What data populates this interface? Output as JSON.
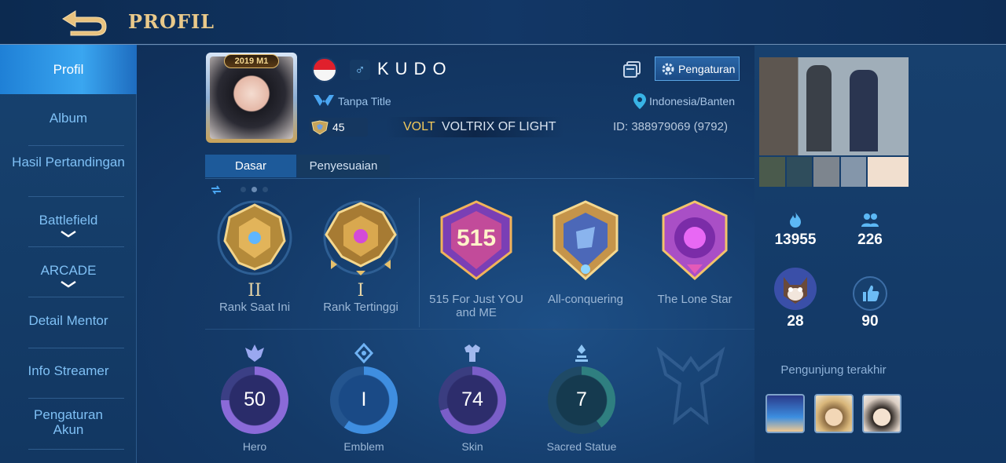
{
  "header": {
    "title": "PROFIL"
  },
  "sidebar": {
    "items": [
      {
        "label": "Profil"
      },
      {
        "label": "Album"
      },
      {
        "label": "Hasil Pertandingan"
      },
      {
        "label": "Battlefield"
      },
      {
        "label": "ARCADE"
      },
      {
        "label": "Detail Mentor"
      },
      {
        "label": "Info Streamer"
      },
      {
        "label": "Pengaturan Akun"
      }
    ]
  },
  "profile": {
    "frame_year": "2019 M1",
    "gender_symbol": "♂",
    "name": "KUDO",
    "title": "Tanpa Title",
    "location": "Indonesia/Banten",
    "level": "45",
    "squad_tag": "VOLT",
    "squad_name": "VOLTRIX OF LIGHT",
    "id_label": "ID:",
    "id_value": "388979069 (9792)",
    "settings_label": "Pengaturan"
  },
  "tabs": [
    {
      "label": "Dasar",
      "active": true
    },
    {
      "label": "Penyesuaian",
      "active": false
    }
  ],
  "medals": [
    {
      "roman": "II",
      "label": "Rank Saat Ini"
    },
    {
      "roman": "I",
      "label": "Rank Tertinggi"
    },
    {
      "label": "515 For Just YOU and ME",
      "art_text": "515"
    },
    {
      "label": "All-conquering"
    },
    {
      "label": "The Lone Star"
    }
  ],
  "stats": [
    {
      "value": "50",
      "label": "Hero",
      "color": "#8a6ad8"
    },
    {
      "value": "I",
      "label": "Emblem",
      "color": "#3f8ee0"
    },
    {
      "value": "74",
      "label": "Skin",
      "color": "#7a5ec8"
    },
    {
      "value": "7",
      "label": "Sacred Statue",
      "color": "#2f7f80"
    }
  ],
  "right": {
    "popularity": "13955",
    "friends": "226",
    "pet_count": "28",
    "likes": "90",
    "visitors_label": "Pengunjung terakhir"
  },
  "colors": {
    "accent": "#e9c98a",
    "link": "#7fc0f5",
    "active_tab": "#1d5a9a"
  }
}
